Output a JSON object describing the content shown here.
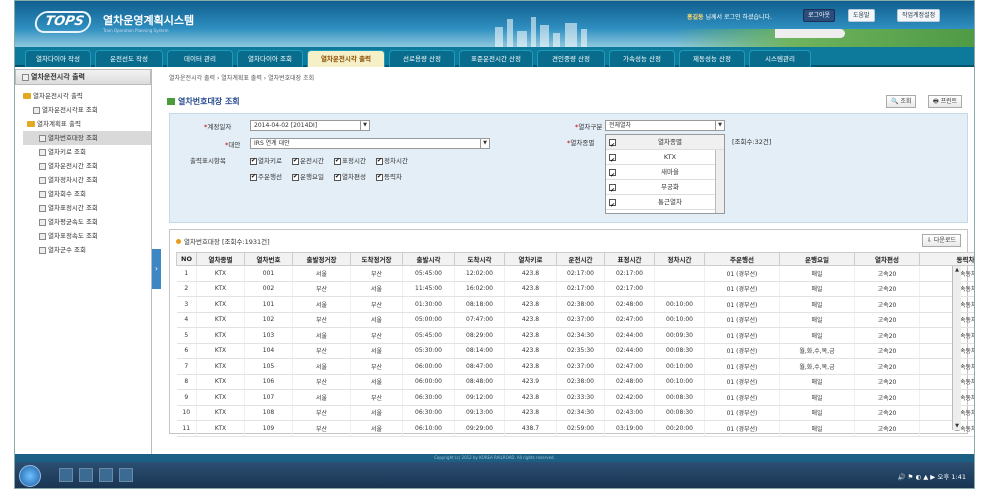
{
  "header": {
    "logo": "TOPS",
    "system_title": "열차운영계획시스템",
    "system_subtitle": "Train Operation Planning System",
    "user_name": "홍길동",
    "user_suffix": "님께서 로그인 하셨습니다.",
    "logout_label": "로그아웃",
    "help_label": "도움말",
    "env_label": "작업계정설정"
  },
  "tabs": [
    "열차다이아 작성",
    "운전선도 작성",
    "데이터 관리",
    "열차다이아 조회",
    "열차운전시각 출력",
    "선로용량 산정",
    "표준운전시간 산정",
    "견인중량 산정",
    "가속성능 산정",
    "제동성능 산정",
    "시스템관리"
  ],
  "sidebar": {
    "title": "열차운전시각 출력",
    "items": [
      "열차운전시각 출력",
      "열차운전시각표 조회",
      "열차계획표 출력",
      "열차번호대장 조회",
      "열차키로 조회",
      "열차운전시간 조회",
      "열차정차시간 조회",
      "열차회수 조회",
      "열차표정시간 조회",
      "열차평균속도 조회",
      "열차표정속도 조회",
      "열차군수 조회"
    ]
  },
  "breadcrumb": [
    "열차운전시각 출력",
    "열차계획표 출력",
    "열차번호대장 조회"
  ],
  "page": {
    "title": "열차번호대장 조회",
    "search_label": "조회",
    "print_label": "프린트"
  },
  "conditions": {
    "date_label": "계정일자",
    "date_value": "2014-04-02 [2014DI]",
    "plan_label": "대안",
    "plan_value": "IRS 연계 대안",
    "type_label": "열차구분",
    "type_value": "전체열차",
    "train_label": "열차종별",
    "train_count": "[조회수:32건]",
    "options_label": "출력표시항목",
    "options_row1": [
      "열차키로",
      "운전시간",
      "표정시간",
      "정차시간"
    ],
    "options_row2": [
      "주운행선",
      "운행요일",
      "열차편성",
      "등력차"
    ],
    "train_list_header": "열차종별",
    "train_list": [
      "KTX",
      "새마을",
      "무궁화",
      "통근열차"
    ]
  },
  "grid": {
    "title": "열차번호대장 [조회수:1931건]",
    "download_label": "다운로드",
    "columns": [
      "NO",
      "열차종별",
      "열차번호",
      "출발정거장",
      "도착정거장",
      "출발시각",
      "도착시각",
      "열차키로",
      "운전시간",
      "표정시간",
      "정차시간",
      "주운행선",
      "운행요일",
      "열차편성",
      "동력차"
    ],
    "rows": [
      [
        "1",
        "KTX",
        "001",
        "서울",
        "부산",
        "05:45:00",
        "12:02:00",
        "423.8",
        "02:17:00",
        "02:17:00",
        "",
        "01 (경부선)",
        "매일",
        "고속20",
        "고속동차"
      ],
      [
        "2",
        "KTX",
        "002",
        "부산",
        "서울",
        "11:45:00",
        "16:02:00",
        "423.8",
        "02:17:00",
        "02:17:00",
        "",
        "01 (경부선)",
        "매일",
        "고속20",
        "고속동차"
      ],
      [
        "3",
        "KTX",
        "101",
        "서울",
        "부산",
        "01:30:00",
        "08:18:00",
        "423.8",
        "02:38:00",
        "02:48:00",
        "00:10:00",
        "01 (경부선)",
        "매일",
        "고속20",
        "고속동차"
      ],
      [
        "4",
        "KTX",
        "102",
        "부산",
        "서울",
        "05:00:00",
        "07:47:00",
        "423.8",
        "02:37:00",
        "02:47:00",
        "00:10:00",
        "01 (경부선)",
        "매일",
        "고속20",
        "고속동차"
      ],
      [
        "5",
        "KTX",
        "103",
        "서울",
        "부산",
        "05:45:00",
        "08:29:00",
        "423.8",
        "02:34:30",
        "02:44:00",
        "00:09:30",
        "01 (경부선)",
        "매일",
        "고속20",
        "고속동차"
      ],
      [
        "6",
        "KTX",
        "104",
        "부산",
        "서울",
        "05:30:00",
        "08:14:00",
        "423.8",
        "02:35:30",
        "02:44:00",
        "00:08:30",
        "01 (경부선)",
        "월,화,수,목,금",
        "고속20",
        "고속동차"
      ],
      [
        "7",
        "KTX",
        "105",
        "서울",
        "부산",
        "06:00:00",
        "08:47:00",
        "423.8",
        "02:37:00",
        "02:47:00",
        "00:10:00",
        "01 (경부선)",
        "월,화,수,목,금",
        "고속20",
        "고속동차"
      ],
      [
        "8",
        "KTX",
        "106",
        "부산",
        "서울",
        "06:00:00",
        "08:48:00",
        "423.9",
        "02:38:00",
        "02:48:00",
        "00:10:00",
        "01 (경부선)",
        "매일",
        "고속20",
        "고속동차"
      ],
      [
        "9",
        "KTX",
        "107",
        "서울",
        "부산",
        "06:30:00",
        "09:12:00",
        "423.8",
        "02:33:30",
        "02:42:00",
        "00:08:30",
        "01 (경부선)",
        "매일",
        "고속20",
        "고속동차"
      ],
      [
        "10",
        "KTX",
        "108",
        "부산",
        "서울",
        "06:30:00",
        "09:13:00",
        "423.8",
        "02:34:30",
        "02:43:00",
        "00:08:30",
        "01 (경부선)",
        "매일",
        "고속20",
        "고속동차"
      ],
      [
        "11",
        "KTX",
        "109",
        "부산",
        "서울",
        "06:10:00",
        "09:29:00",
        "438.7",
        "02:59:00",
        "03:19:00",
        "00:20:00",
        "01 (경부선)",
        "매일",
        "고속20",
        "고속동차"
      ]
    ]
  },
  "footer": "Copyright (c) 2012 by KOREA RAILROAD. All rights reserved.",
  "taskbar": {
    "clock": "오후 1:41"
  }
}
